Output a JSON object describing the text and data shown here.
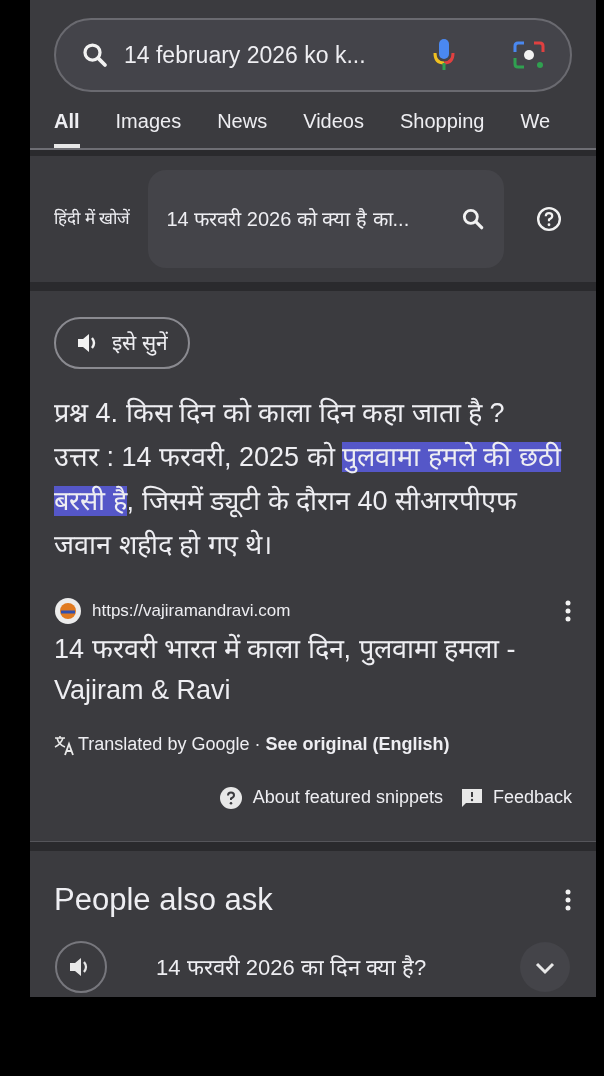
{
  "search": {
    "value": "14 february 2026 ko k..."
  },
  "tabs": [
    {
      "label": "All",
      "selected": true
    },
    {
      "label": "Images",
      "selected": false
    },
    {
      "label": "News",
      "selected": false
    },
    {
      "label": "Videos",
      "selected": false
    },
    {
      "label": "Shopping",
      "selected": false
    },
    {
      "label": "We",
      "selected": false
    }
  ],
  "hindi_search": {
    "label": "हिंदी में खोजें",
    "value": "14 फरवरी 2026 को क्या है का..."
  },
  "featured_snippet": {
    "listen_label": "इसे सुनें",
    "answer": [
      {
        "text": "प्रश्न 4. किस दिन को काला दिन कहा जाता है ?\nउत्तर : 14 फरवरी, 2025 को ",
        "highlighted": false
      },
      {
        "text": "पुलवामा हमले की छठी बरसी है",
        "highlighted": true
      },
      {
        "text": ", जिसमें ड्यूटी के दौरान 40 सीआरपीएफ जवान शहीद हो गए थे।",
        "highlighted": false
      }
    ],
    "source_url": "https://vajiramandravi.com",
    "title": "14 फरवरी भारत में काला दिन, पुलवामा हमला - Vajiram & Ravi",
    "translation": "Translated by Google · **See original (English)**",
    "about": "About featured snippets",
    "feedback": "Feedback"
  },
  "people_also_ask": {
    "title": "People also ask",
    "questions": [
      {
        "text": "14 फरवरी 2026 का दिन क्या है?"
      }
    ]
  }
}
